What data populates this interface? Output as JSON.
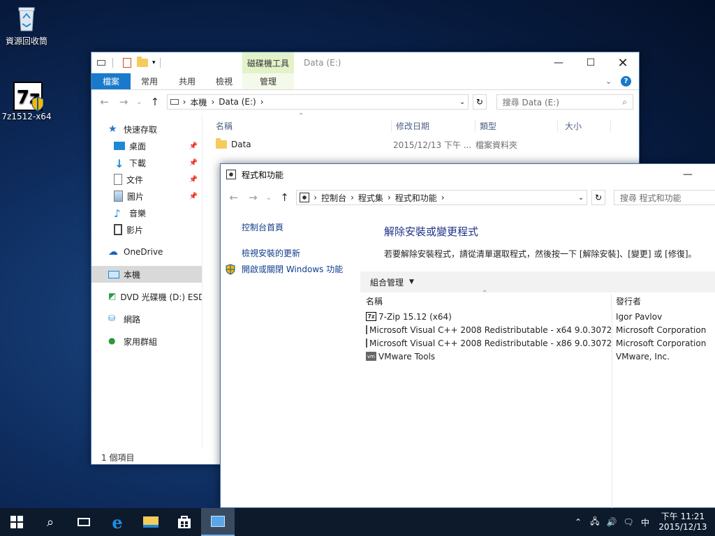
{
  "desktop": {
    "icons": [
      {
        "label": "資源回收筒"
      },
      {
        "label": "7z1512-x64"
      }
    ]
  },
  "explorer": {
    "title": "Data (E:)",
    "contextual_tab_group": "磁碟機工具",
    "tabs": [
      "檔案",
      "常用",
      "共用",
      "檢視",
      "管理"
    ],
    "address": [
      "本機",
      "Data (E:)"
    ],
    "search_placeholder": "搜尋 Data (E:)",
    "columns": [
      "名稱",
      "修改日期",
      "類型",
      "大小"
    ],
    "files": [
      {
        "name": "Data",
        "modified": "2015/12/13 下午 ...",
        "type": "檔案資料夾",
        "size": ""
      }
    ],
    "nav": {
      "quick_access": "快速存取",
      "pinned": [
        "桌面",
        "下載",
        "文件",
        "圖片"
      ],
      "others": [
        "音樂",
        "影片"
      ],
      "onedrive": "OneDrive",
      "this_pc": "本機",
      "dvd": "DVD 光碟機 (D:) ESD",
      "network": "網路",
      "homegroup": "家用群組"
    },
    "status": "1 個項目"
  },
  "control_panel": {
    "title": "程式和功能",
    "address": [
      "控制台",
      "程式集",
      "程式和功能"
    ],
    "search_placeholder": "搜尋 程式和功能",
    "sidebar": {
      "home": "控制台首頁",
      "view_updates": "檢視安裝的更新",
      "windows_features": "開啟或關閉 Windows 功能"
    },
    "heading": "解除安裝或變更程式",
    "description": "若要解除安裝程式，請從清單選取程式，然後按一下 [解除安裝]、[變更] 或 [修復]。",
    "organize": "組合管理",
    "columns": [
      "名稱",
      "發行者"
    ],
    "programs": [
      {
        "name": "7-Zip 15.12 (x64)",
        "publisher": "Igor Pavlov",
        "icon": "7zip-icon"
      },
      {
        "name": "Microsoft Visual C++ 2008 Redistributable - x64 9.0.3072...",
        "publisher": "Microsoft Corporation",
        "icon": "installer-icon"
      },
      {
        "name": "Microsoft Visual C++ 2008 Redistributable - x86 9.0.3072...",
        "publisher": "Microsoft Corporation",
        "icon": "installer-icon"
      },
      {
        "name": "VMware Tools",
        "publisher": "VMware, Inc.",
        "icon": "vmware-icon"
      }
    ]
  },
  "taskbar": {
    "ime": "中",
    "time": "下午 11:21",
    "date": "2015/12/13"
  },
  "colors": {
    "accent": "#1979ca",
    "link": "#0f3d8c",
    "heading": "#1e3287",
    "contextual_tab": "#e3f2c9"
  }
}
